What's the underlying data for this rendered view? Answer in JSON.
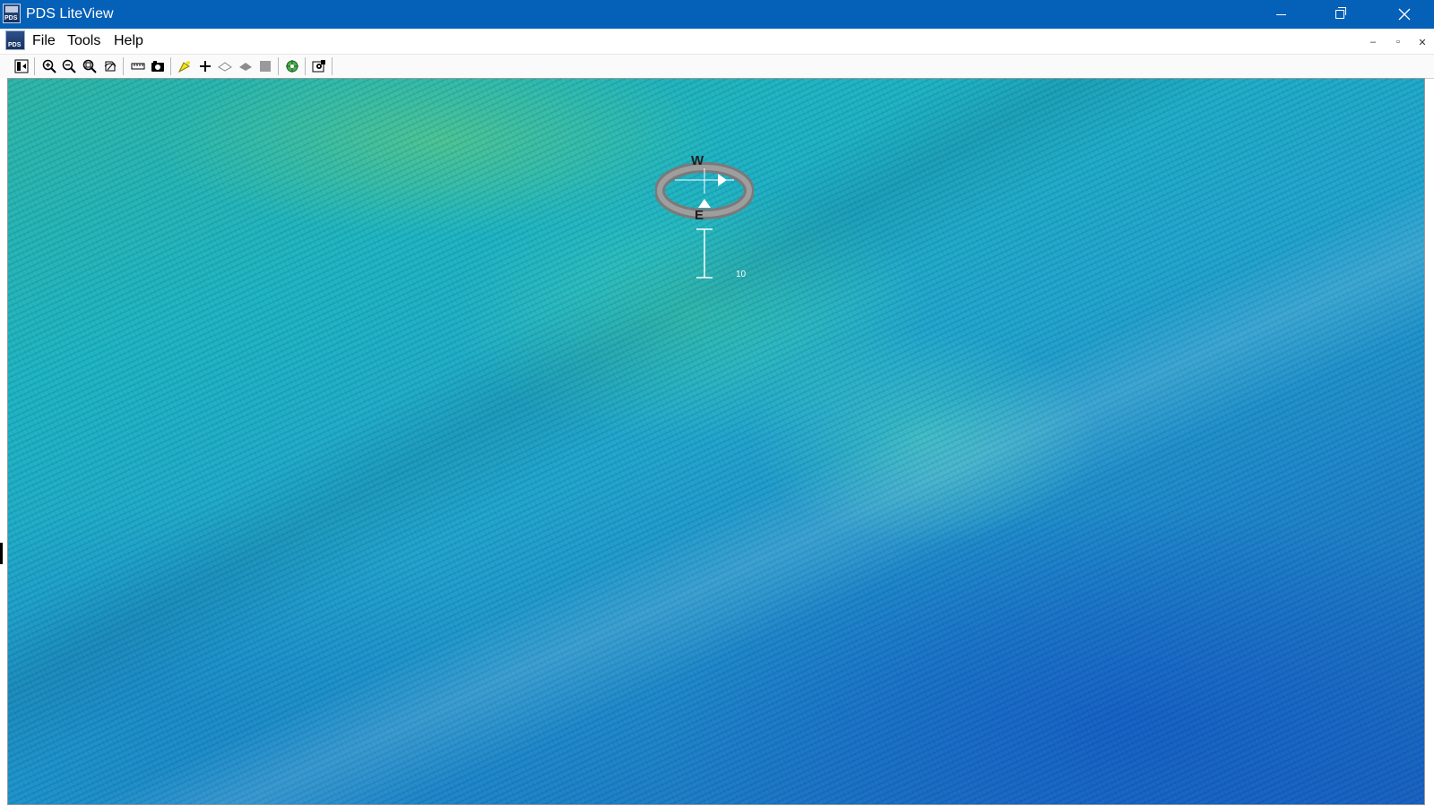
{
  "window": {
    "title": "PDS LiteView",
    "app_icon_text": "PDS",
    "buttons": [
      "minimize",
      "restore",
      "close"
    ]
  },
  "menu": {
    "items": [
      "File",
      "Tools",
      "Help"
    ]
  },
  "toolbar": {
    "buttons": [
      "view-panel-icon",
      "zoom-in-icon",
      "zoom-out-icon",
      "zoom-window-icon",
      "reset-view-icon",
      "measure-icon",
      "screenshot-icon",
      "color-highlight-icon",
      "add-point-icon",
      "surface-outline-icon",
      "surface-fill-icon",
      "solid-fill-icon",
      "navigation-target-icon",
      "settings-icon"
    ]
  },
  "viewport": {
    "compass": {
      "north_label": "W",
      "south_label": "E"
    },
    "scale_label": "10"
  },
  "colors": {
    "titlebar": "#0560b8",
    "seabed_shallow": "#2fd4a5",
    "seabed_deep": "#1a66c0"
  }
}
